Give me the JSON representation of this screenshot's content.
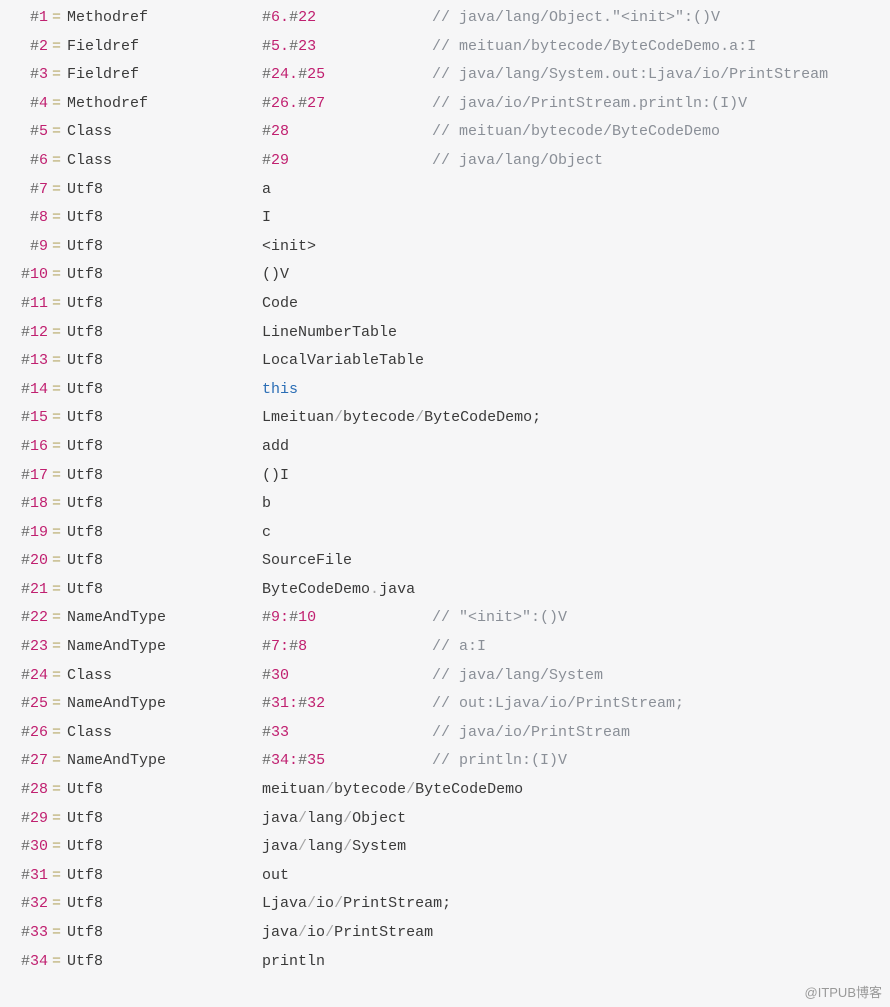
{
  "watermark": "@ITPUB博客",
  "entries": [
    {
      "idx": "1",
      "kind": "Methodref",
      "valTokens": [
        [
          "hash",
          "#"
        ],
        [
          "magenta",
          "6"
        ],
        [
          "magenta",
          "."
        ],
        [
          "hash",
          "#"
        ],
        [
          "magenta",
          "22"
        ]
      ],
      "comment": "// java/lang/Object.\"<init>\":()V"
    },
    {
      "idx": "2",
      "kind": "Fieldref",
      "valTokens": [
        [
          "hash",
          "#"
        ],
        [
          "magenta",
          "5"
        ],
        [
          "magenta",
          "."
        ],
        [
          "hash",
          "#"
        ],
        [
          "magenta",
          "23"
        ]
      ],
      "comment": "// meituan/bytecode/ByteCodeDemo.a:I"
    },
    {
      "idx": "3",
      "kind": "Fieldref",
      "valTokens": [
        [
          "hash",
          "#"
        ],
        [
          "magenta",
          "24"
        ],
        [
          "magenta",
          "."
        ],
        [
          "hash",
          "#"
        ],
        [
          "magenta",
          "25"
        ]
      ],
      "comment": "// java/lang/System.out:Ljava/io/PrintStream"
    },
    {
      "idx": "4",
      "kind": "Methodref",
      "valTokens": [
        [
          "hash",
          "#"
        ],
        [
          "magenta",
          "26"
        ],
        [
          "magenta",
          "."
        ],
        [
          "hash",
          "#"
        ],
        [
          "magenta",
          "27"
        ]
      ],
      "comment": "// java/io/PrintStream.println:(I)V"
    },
    {
      "idx": "5",
      "kind": "Class",
      "valTokens": [
        [
          "hash",
          "#"
        ],
        [
          "magenta",
          "28"
        ]
      ],
      "comment": "// meituan/bytecode/ByteCodeDemo"
    },
    {
      "idx": "6",
      "kind": "Class",
      "valTokens": [
        [
          "hash",
          "#"
        ],
        [
          "magenta",
          "29"
        ]
      ],
      "comment": "// java/lang/Object"
    },
    {
      "idx": "7",
      "kind": "Utf8",
      "valTokens": [
        [
          "seg",
          "a"
        ]
      ]
    },
    {
      "idx": "8",
      "kind": "Utf8",
      "valTokens": [
        [
          "seg",
          "I"
        ]
      ]
    },
    {
      "idx": "9",
      "kind": "Utf8",
      "valTokens": [
        [
          "seg",
          "<init>"
        ]
      ]
    },
    {
      "idx": "10",
      "kind": "Utf8",
      "valTokens": [
        [
          "seg",
          "()V"
        ]
      ]
    },
    {
      "idx": "11",
      "kind": "Utf8",
      "valTokens": [
        [
          "seg",
          "Code"
        ]
      ]
    },
    {
      "idx": "12",
      "kind": "Utf8",
      "valTokens": [
        [
          "seg",
          "LineNumberTable"
        ]
      ]
    },
    {
      "idx": "13",
      "kind": "Utf8",
      "valTokens": [
        [
          "seg",
          "LocalVariableTable"
        ]
      ]
    },
    {
      "idx": "14",
      "kind": "Utf8",
      "valTokens": [
        [
          "kw",
          "this"
        ]
      ]
    },
    {
      "idx": "15",
      "kind": "Utf8",
      "valTokens": [
        [
          "seg",
          "Lmeituan"
        ],
        [
          "slash",
          "/"
        ],
        [
          "seg",
          "bytecode"
        ],
        [
          "slash",
          "/"
        ],
        [
          "seg",
          "ByteCodeDemo"
        ],
        [
          "seg",
          ";"
        ]
      ]
    },
    {
      "idx": "16",
      "kind": "Utf8",
      "valTokens": [
        [
          "seg",
          "add"
        ]
      ]
    },
    {
      "idx": "17",
      "kind": "Utf8",
      "valTokens": [
        [
          "seg",
          "()I"
        ]
      ]
    },
    {
      "idx": "18",
      "kind": "Utf8",
      "valTokens": [
        [
          "seg",
          "b"
        ]
      ]
    },
    {
      "idx": "19",
      "kind": "Utf8",
      "valTokens": [
        [
          "seg",
          "c"
        ]
      ]
    },
    {
      "idx": "20",
      "kind": "Utf8",
      "valTokens": [
        [
          "seg",
          "SourceFile"
        ]
      ]
    },
    {
      "idx": "21",
      "kind": "Utf8",
      "valTokens": [
        [
          "seg",
          "ByteCodeDemo"
        ],
        [
          "slash",
          "."
        ],
        [
          "seg",
          "java"
        ]
      ]
    },
    {
      "idx": "22",
      "kind": "NameAndType",
      "valTokens": [
        [
          "hash",
          "#"
        ],
        [
          "magenta",
          "9"
        ],
        [
          "magenta",
          ":"
        ],
        [
          "hash",
          "#"
        ],
        [
          "magenta",
          "10"
        ]
      ],
      "comment": "// \"<init>\":()V"
    },
    {
      "idx": "23",
      "kind": "NameAndType",
      "valTokens": [
        [
          "hash",
          "#"
        ],
        [
          "magenta",
          "7"
        ],
        [
          "magenta",
          ":"
        ],
        [
          "hash",
          "#"
        ],
        [
          "magenta",
          "8"
        ]
      ],
      "comment": "// a:I"
    },
    {
      "idx": "24",
      "kind": "Class",
      "valTokens": [
        [
          "hash",
          "#"
        ],
        [
          "magenta",
          "30"
        ]
      ],
      "comment": "// java/lang/System"
    },
    {
      "idx": "25",
      "kind": "NameAndType",
      "valTokens": [
        [
          "hash",
          "#"
        ],
        [
          "magenta",
          "31"
        ],
        [
          "magenta",
          ":"
        ],
        [
          "hash",
          "#"
        ],
        [
          "magenta",
          "32"
        ]
      ],
      "comment": "// out:Ljava/io/PrintStream;"
    },
    {
      "idx": "26",
      "kind": "Class",
      "valTokens": [
        [
          "hash",
          "#"
        ],
        [
          "magenta",
          "33"
        ]
      ],
      "comment": "// java/io/PrintStream"
    },
    {
      "idx": "27",
      "kind": "NameAndType",
      "valTokens": [
        [
          "hash",
          "#"
        ],
        [
          "magenta",
          "34"
        ],
        [
          "magenta",
          ":"
        ],
        [
          "hash",
          "#"
        ],
        [
          "magenta",
          "35"
        ]
      ],
      "comment": "// println:(I)V"
    },
    {
      "idx": "28",
      "kind": "Utf8",
      "valTokens": [
        [
          "seg",
          "meituan"
        ],
        [
          "slash",
          "/"
        ],
        [
          "seg",
          "bytecode"
        ],
        [
          "slash",
          "/"
        ],
        [
          "seg",
          "ByteCodeDemo"
        ]
      ]
    },
    {
      "idx": "29",
      "kind": "Utf8",
      "valTokens": [
        [
          "seg",
          "java"
        ],
        [
          "slash",
          "/"
        ],
        [
          "seg",
          "lang"
        ],
        [
          "slash",
          "/"
        ],
        [
          "seg",
          "Object"
        ]
      ]
    },
    {
      "idx": "30",
      "kind": "Utf8",
      "valTokens": [
        [
          "seg",
          "java"
        ],
        [
          "slash",
          "/"
        ],
        [
          "seg",
          "lang"
        ],
        [
          "slash",
          "/"
        ],
        [
          "seg",
          "System"
        ]
      ]
    },
    {
      "idx": "31",
      "kind": "Utf8",
      "valTokens": [
        [
          "seg",
          "out"
        ]
      ]
    },
    {
      "idx": "32",
      "kind": "Utf8",
      "valTokens": [
        [
          "seg",
          "Ljava"
        ],
        [
          "slash",
          "/"
        ],
        [
          "seg",
          "io"
        ],
        [
          "slash",
          "/"
        ],
        [
          "seg",
          "PrintStream"
        ],
        [
          "seg",
          ";"
        ]
      ]
    },
    {
      "idx": "33",
      "kind": "Utf8",
      "valTokens": [
        [
          "seg",
          "java"
        ],
        [
          "slash",
          "/"
        ],
        [
          "seg",
          "io"
        ],
        [
          "slash",
          "/"
        ],
        [
          "seg",
          "PrintStream"
        ]
      ]
    },
    {
      "idx": "34",
      "kind": "Utf8",
      "valTokens": [
        [
          "seg",
          "println"
        ]
      ]
    }
  ]
}
